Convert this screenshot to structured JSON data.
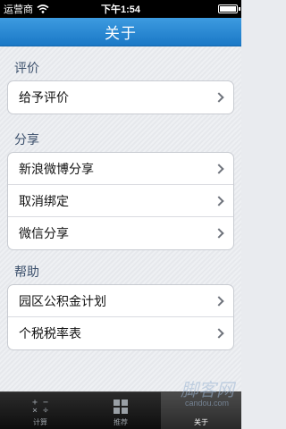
{
  "status_bar": {
    "carrier": "运营商",
    "time": "下午1:54"
  },
  "nav": {
    "title": "关于"
  },
  "sections": {
    "rate": {
      "header": "评价",
      "items": [
        "给予评价"
      ]
    },
    "share": {
      "header": "分享",
      "items": [
        "新浪微博分享",
        "取消绑定",
        "微信分享"
      ]
    },
    "help": {
      "header": "帮助",
      "items": [
        "园区公积金计划",
        "个税税率表"
      ]
    }
  },
  "tab_bar": {
    "tabs": [
      {
        "label": "计算",
        "icon": "calculator-icon"
      },
      {
        "label": "推荐",
        "icon": "grid-icon"
      },
      {
        "label": "关于",
        "icon": "info-icon"
      }
    ],
    "active_index": 2
  },
  "watermark": {
    "text": "脚客网",
    "sub": "candou.com"
  },
  "colors": {
    "nav_bar": "#1a78c6",
    "section_header": "#3b4f6b",
    "tab_bar": "#0e0e0e"
  }
}
